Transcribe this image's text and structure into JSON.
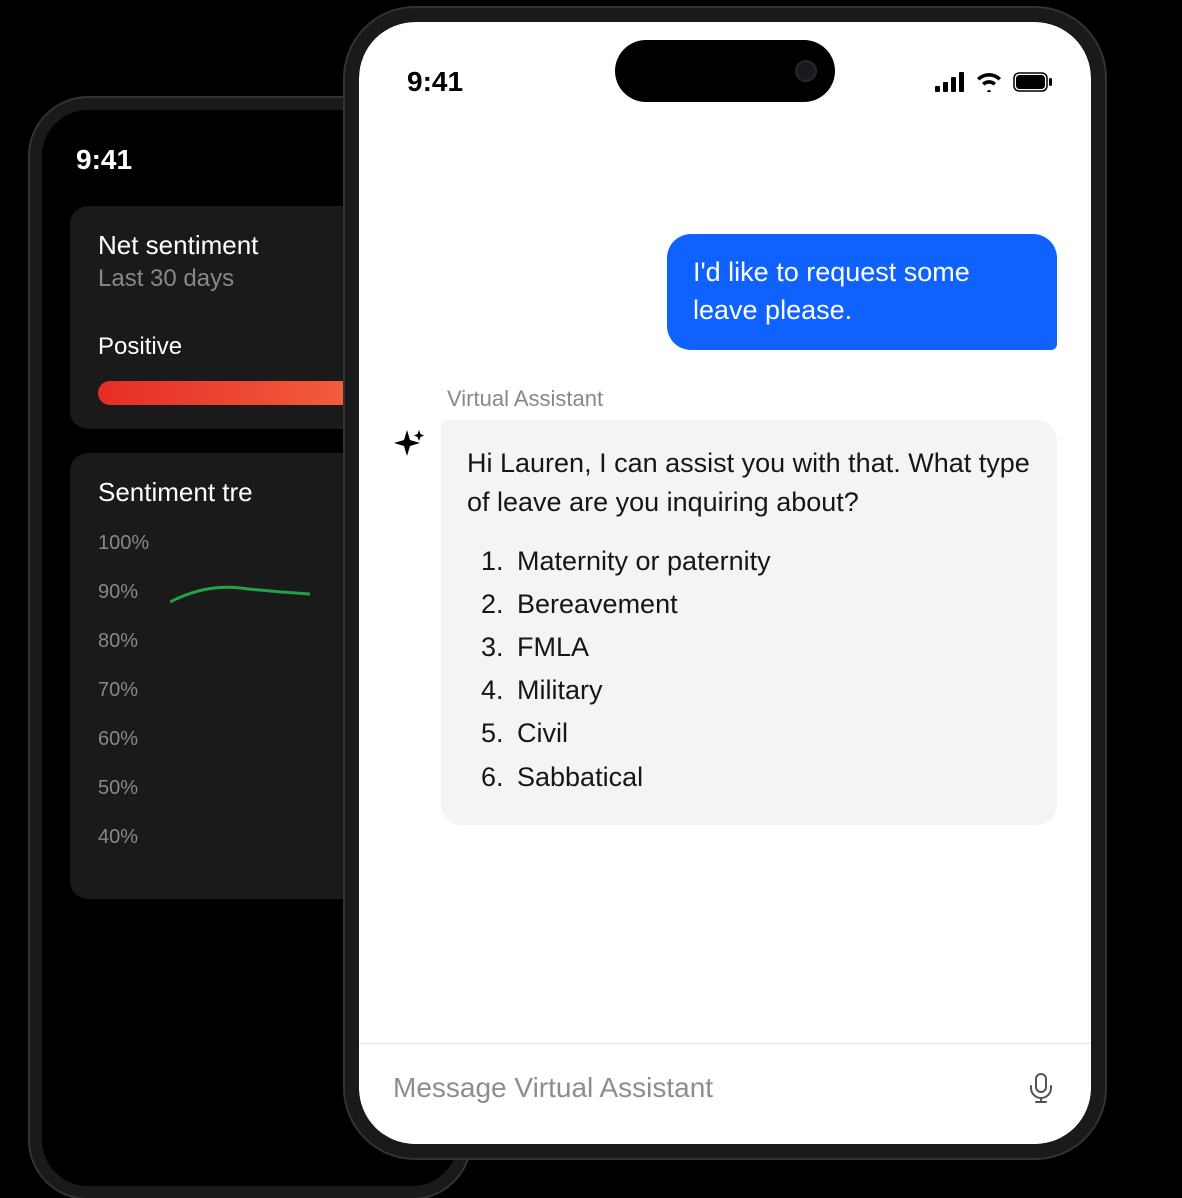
{
  "back_phone": {
    "status_time": "9:41",
    "card1": {
      "title": "Net sentiment",
      "subtitle": "Last 30 days",
      "positive_label": "Positive"
    },
    "card2": {
      "title": "Sentiment tre",
      "y_axis": [
        "100%",
        "90%",
        "80%",
        "70%",
        "60%",
        "50%",
        "40%"
      ]
    }
  },
  "front_phone": {
    "status_time": "9:41",
    "user_message": "I'd like to request some leave please.",
    "assistant_label": "Virtual Assistant",
    "assistant_message": "Hi Lauren, I can assist you with that. What type of leave are you inquiring about?",
    "leave_options": [
      "Maternity or paternity",
      "Bereavement",
      "FMLA",
      "Military",
      "Civil",
      "Sabbatical"
    ],
    "input_placeholder": "Message Virtual Assistant"
  },
  "chart_data": {
    "type": "line",
    "title": "Sentiment trend",
    "ylabel": "",
    "ylim": [
      40,
      100
    ],
    "y_ticks": [
      100,
      90,
      80,
      70,
      60,
      50,
      40
    ],
    "series": [
      {
        "name": "Sentiment",
        "values": [
          88,
          91,
          90
        ]
      }
    ]
  }
}
